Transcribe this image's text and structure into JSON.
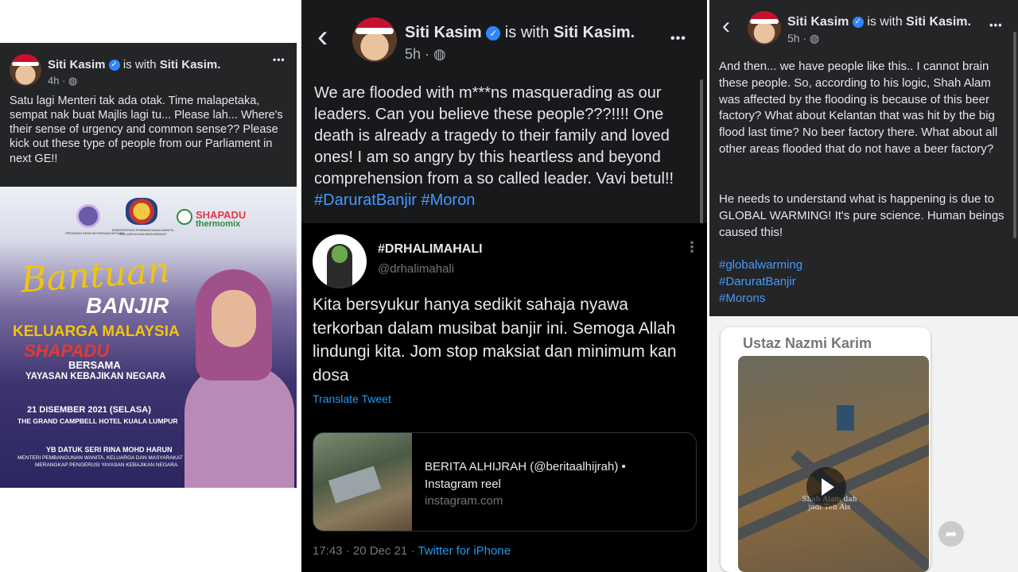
{
  "post1": {
    "author": "Siti Kasim",
    "with_text": "is with",
    "with_name": "Siti Kasim.",
    "time": "4h",
    "menu": "•••",
    "text": "Satu lagi Menteri tak ada otak. Time malapetaka, sempat nak buat Majlis lagi tu... Please lah... Where's their sense of urgency and common sense?? Please kick out these type of people from our Parliament in next GE!!",
    "poster": {
      "logo1_caption": "PROGRAM KESEJAHTERAAN NEGARA",
      "logo2_caption": "KEMENTERIAN PEMBANGUNAN WANITA, KELUARGA DAN MASYARAKAT",
      "brand1": "SHAPADU",
      "brand2": "thermomix",
      "title1": "Bantuan",
      "title2": "BANJIR",
      "line1": "KELUARGA MALAYSIA",
      "line2": "SHAPADU",
      "line3": "BERSAMA",
      "line4": "YAYASAN KEBAJIKAN NEGARA",
      "date": "21 DISEMBER 2021 (SELASA)",
      "venue": "THE GRAND CAMPBELL HOTEL KUALA LUMPUR",
      "vip": "YB DATUK SERI RINA MOHD HARUN",
      "vip_role1": "MENTERI PEMBANGUNAN WANITA, KELUARGA DAN MASYARAKAT",
      "vip_role2": "MERANGKAP PENGERUSI YAYASAN KEBAJIKAN NEGARA"
    }
  },
  "post2": {
    "back": "‹",
    "author": "Siti Kasim",
    "with_text": "is with",
    "with_name": "Siti Kasim.",
    "time": "5h",
    "menu": "•••",
    "text": "We are flooded with m***ns masquerading as our leaders. Can you believe these people???!!!! One death is already a tragedy to their family and loved ones! I am so angry by this heartless and beyond comprehension from a so called leader. Vavi betul!!",
    "hashtags": "#DaruratBanjir #Moron",
    "tweet": {
      "name": "#DRHALIMAHALI",
      "handle": "@drhalimahali",
      "menu": "⋮",
      "text": "Kita bersyukur hanya sedikit sahaja nyawa terkorban dalam musibat banjir ini. Semoga Allah lindungi kita. Jom stop maksiat dan minimum kan dosa",
      "translate": "Translate Tweet",
      "link_title": "BERITA ALHIJRAH (@beritaalhijrah) •",
      "link_subtitle": "Instagram reel",
      "link_domain": "instagram.com",
      "timestamp": "17:43 · 20 Dec 21 · ",
      "source": "Twitter for iPhone"
    }
  },
  "post3": {
    "back": "‹",
    "author": "Siti Kasim",
    "with_text": "is with",
    "with_name": "Siti Kasim.",
    "time": "5h",
    "menu": "•••",
    "para1": "And then... we have people like this.. I cannot brain these people. So, according to his logic, Shah Alam was affected by the flooding is because of this beer factory? What about Kelantan that was hit by the big flood last time? No beer factory there. What about all other areas flooded that do not have a beer factory?",
    "para2": "He needs to understand what is happening is due to GLOBAL WARMING! It's pure science. Human beings caused this!",
    "tags": [
      "#globalwarming",
      "#DaruratBanjir",
      "#Morons"
    ],
    "video": {
      "caption": "Ustaz Nazmi Karim",
      "overlay": "Shah Alam dah jadi Teh Ais",
      "share_icon": "➦"
    }
  },
  "colors": {
    "fb_dark": "#242526",
    "link_blue": "#4599ff",
    "verified": "#2d88ff"
  }
}
